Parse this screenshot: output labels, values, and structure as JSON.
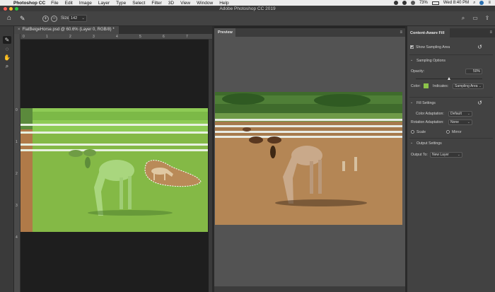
{
  "menubar": {
    "app_name": "Photoshop CC",
    "items": [
      "File",
      "Edit",
      "Image",
      "Layer",
      "Type",
      "Select",
      "Filter",
      "3D",
      "View",
      "Window",
      "Help"
    ],
    "battery": "73%",
    "clock": "Wed 8:40 PM"
  },
  "window": {
    "title": "Adobe Photoshop CC 2019"
  },
  "options": {
    "size_label": "Size:",
    "size_value": "142"
  },
  "document": {
    "tab_title": "FlatBeigeHorse.psd @ 60.6% (Layer 0, RGB/8) *",
    "ruler_h": [
      "0",
      "1",
      "2",
      "3",
      "4",
      "5",
      "6",
      "7"
    ],
    "ruler_v": [
      "0",
      "1",
      "2",
      "3",
      "4"
    ]
  },
  "preview": {
    "tab_label": "Preview"
  },
  "panel": {
    "tab_label": "Content-Aware Fill",
    "show_sampling_area": "Show Sampling Area",
    "sampling_options": "Sampling Options",
    "opacity_label": "Opacity:",
    "opacity_value": "50%",
    "opacity_fraction": 0.5,
    "color_label": "Color:",
    "color_hex": "#8bc34a",
    "indicates_label": "Indicates:",
    "indicates_value": "Sampling Area",
    "fill_settings": "Fill Settings",
    "color_adaptation_label": "Color Adaptation:",
    "color_adaptation_value": "Default",
    "rotation_adaptation_label": "Rotation Adaptation:",
    "rotation_adaptation_value": "None",
    "scale_label": "Scale",
    "mirror_label": "Mirror",
    "output_settings": "Output Settings",
    "output_to_label": "Output To:",
    "output_to_value": "New Layer"
  },
  "colors": {
    "accent": "#8bc34a",
    "close": "#ff5f57",
    "minimize": "#febc2e",
    "zoom": "#28c840"
  },
  "icons": {
    "home": "home-icon",
    "brush": "brush-icon",
    "plus": "plus-circle-icon",
    "minus": "minus-circle-icon",
    "search": "search-icon",
    "workspace": "workspace-icon",
    "share": "share-icon"
  }
}
